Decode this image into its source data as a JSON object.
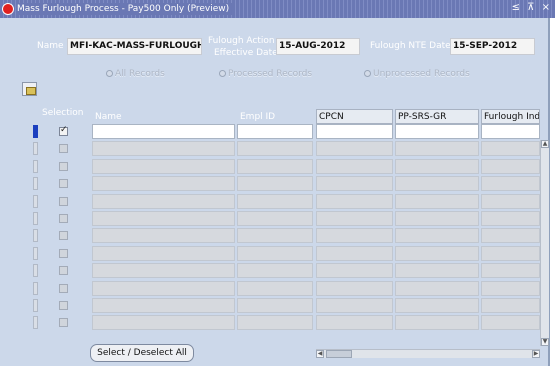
{
  "window": {
    "title": "Mass Furlough Process - Pay500 Only (Preview)",
    "controls": "≤ ⊼ ×"
  },
  "header": {
    "name_label": "Name",
    "name_value": "MFI-KAC-MASS-FURLOUGH-",
    "action_date_label_1": "Fulough Action",
    "action_date_label_2": "Effective Date",
    "action_date_value": "15-AUG-2012",
    "nte_label": "Fulough NTE Date",
    "nte_value": "15-SEP-2012"
  },
  "filters": [
    {
      "label": "All Records"
    },
    {
      "label": "Processed Records"
    },
    {
      "label": "Unprocessed Records"
    }
  ],
  "table": {
    "selection_header": "Selection",
    "columns": [
      "Name",
      "Empl ID",
      "CPCN",
      "PP-SRS-GR",
      "Furlough Indic"
    ],
    "row_count": 12,
    "selected_rows": [
      0
    ]
  },
  "footer": {
    "select_button_label": "Select / Deselect  All"
  },
  "colors": {
    "titlebar": "#6a78b4",
    "background": "#ccd8ea",
    "current_row_indicator": "#1b3fbf"
  }
}
